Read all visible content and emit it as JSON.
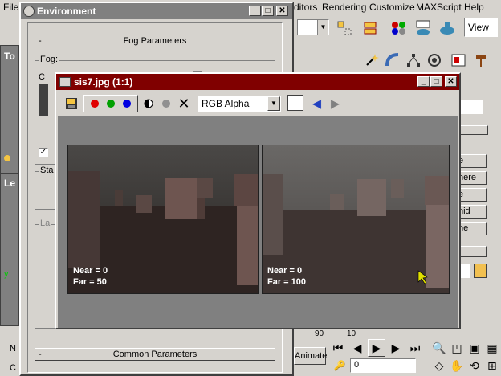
{
  "menubar": {
    "items": [
      "File",
      "ditors",
      "Rendering",
      "Customize",
      "MAXScript",
      "Help"
    ]
  },
  "max_toolbar": {
    "view_select": "View"
  },
  "viewports": {
    "top_label": "To",
    "left_label": "Le"
  },
  "command_panel": {
    "buttons": [
      "e",
      "here",
      "e",
      "nid",
      "ne"
    ]
  },
  "bottom": {
    "animate_label": "Animate",
    "frame_value": "0",
    "ruler_a": "90",
    "ruler_b": "10"
  },
  "left_strip": {
    "label_n": "N",
    "label_c": "C",
    "axis_y": "y"
  },
  "env_window": {
    "title": "Environment",
    "fog_rollout": "Fog Parameters",
    "fog_group": "Fog:",
    "col_label": "C",
    "hint_text": "u",
    "standard_group": "Sta",
    "layered_group": "La",
    "common_rollout": "Common Parameters"
  },
  "sis_window": {
    "title": "sis7.jpg (1:1)",
    "channel_select": "RGB Alpha",
    "left_panel": {
      "near": "Near = 0",
      "far": "Far = 50"
    },
    "right_panel": {
      "near": "Near = 0",
      "far": "Far = 100"
    }
  },
  "colors": {
    "sis_title_bg": "#800000",
    "env_title_bg": "#808080",
    "face": "#d6d3ce"
  }
}
